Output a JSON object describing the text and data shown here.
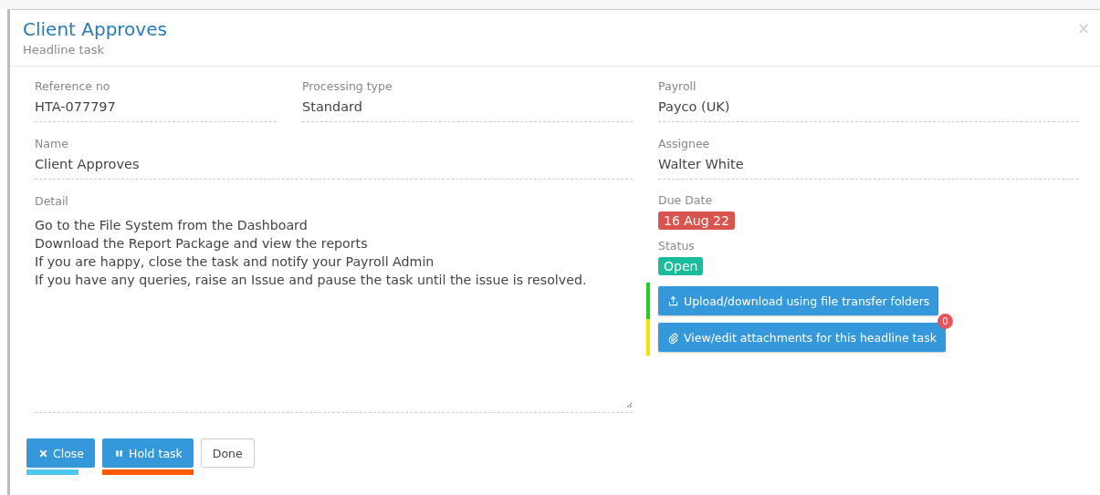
{
  "modal": {
    "title": "Client Approves",
    "subtitle": "Headline task",
    "close_icon": "×"
  },
  "fields_left": [
    {
      "label": "Reference no",
      "value": "HTA-077797"
    },
    {
      "label": "Processing type",
      "value": "Standard"
    },
    {
      "label": "Name",
      "value": "Client Approves"
    }
  ],
  "detail": {
    "label": "Detail",
    "lines": [
      "Go to the File System from the Dashboard",
      "Download the Report Package and view the reports",
      "If you are happy, close the task and notify your Payroll Admin",
      "If you have any queries, raise an Issue and pause the task until the issue is resolved."
    ]
  },
  "fields_right": [
    {
      "label": "Payroll",
      "value": "Payco (UK)"
    },
    {
      "label": "Assignee",
      "value": "Walter White"
    }
  ],
  "due_date": {
    "label": "Due Date",
    "value": "16 Aug 22",
    "color": "#d9534f"
  },
  "status": {
    "label": "Status",
    "value": "Open",
    "color": "#1abc9c"
  },
  "actions": [
    {
      "kind": "upload",
      "label": "Upload/download using file transfer folders",
      "color": "#22cc22"
    },
    {
      "kind": "attach",
      "label": "View/edit attachments for this headline task",
      "badge": "0",
      "color": "#f5e000"
    }
  ],
  "footer_buttons": [
    {
      "kind": "close",
      "label": "Close",
      "color": "#4dc8f0"
    },
    {
      "kind": "hold",
      "label": "Hold task",
      "color": "#ff5a00"
    },
    {
      "kind": "done",
      "label": "Done"
    }
  ]
}
